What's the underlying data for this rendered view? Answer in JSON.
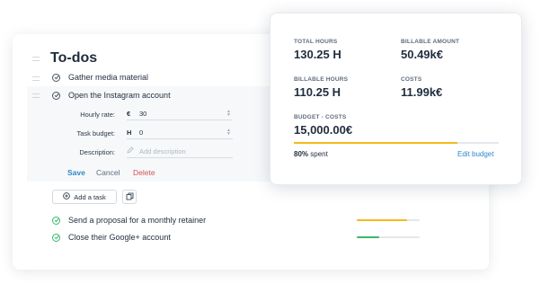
{
  "todos": {
    "title": "To-dos",
    "tasks": [
      {
        "label": "Gather media material"
      },
      {
        "label": "Open the Instagram account"
      }
    ],
    "form": {
      "hourly_rate_label": "Hourly rate:",
      "hourly_rate_prefix": "€",
      "hourly_rate_value": "30",
      "task_budget_label": "Task budget:",
      "task_budget_prefix": "H",
      "task_budget_value": "0",
      "description_label": "Description:",
      "description_placeholder": "Add description",
      "save_label": "Save",
      "cancel_label": "Cancel",
      "delete_label": "Delete"
    },
    "add_task_label": "Add a task",
    "completed": [
      {
        "label": "Send a proposal for a monthly retainer",
        "progress": 0.8,
        "color": "#f4b91a"
      },
      {
        "label": "Close their Google+ account",
        "progress": 0.35,
        "color": "#38b86b"
      }
    ]
  },
  "budget": {
    "total_hours_label": "TOTAL HOURS",
    "total_hours_value": "130.25 H",
    "billable_amount_label": "BILLABLE AMOUNT",
    "billable_amount_value": "50.49k€",
    "billable_hours_label": "BILLABLE HOURS",
    "billable_hours_value": "110.25 H",
    "costs_label": "COSTS",
    "costs_value": "11.99k€",
    "budget_costs_label": "BUDGET - COSTS",
    "budget_costs_value": "15,000.00€",
    "spent_percent": "80%",
    "spent_suffix": "spent",
    "spent_fraction": 0.8,
    "edit_label": "Edit budget"
  },
  "colors": {
    "accent_blue": "#2f88c9",
    "delete_red": "#d9534f",
    "budget_bar": "#f4b91a",
    "success_green": "#38b86b"
  }
}
